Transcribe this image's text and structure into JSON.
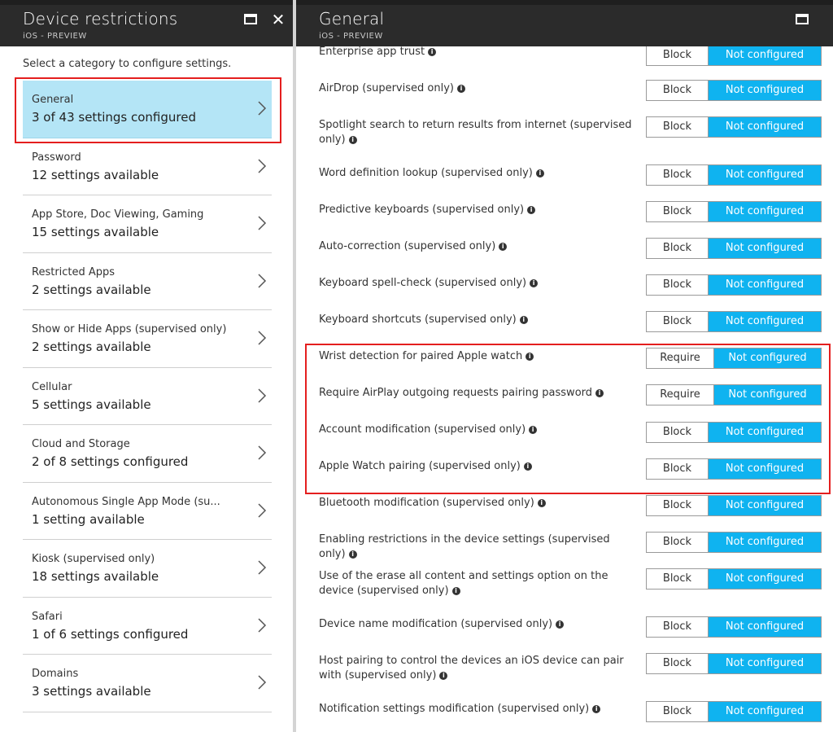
{
  "left": {
    "title": "Device restrictions",
    "subtitle": "iOS - PREVIEW",
    "intro": "Select a category to configure settings.",
    "categories": [
      {
        "title": "General",
        "sub": "3 of 43 settings configured"
      },
      {
        "title": "Password",
        "sub": "12 settings available"
      },
      {
        "title": "App Store, Doc Viewing, Gaming",
        "sub": "15 settings available"
      },
      {
        "title": "Restricted Apps",
        "sub": "2 settings available"
      },
      {
        "title": "Show or Hide Apps (supervised only)",
        "sub": "2 settings available"
      },
      {
        "title": "Cellular",
        "sub": "5 settings available"
      },
      {
        "title": "Cloud and Storage",
        "sub": "2 of 8 settings configured"
      },
      {
        "title": "Autonomous Single App Mode (su...",
        "sub": "1 setting available"
      },
      {
        "title": "Kiosk (supervised only)",
        "sub": "18 settings available"
      },
      {
        "title": "Safari",
        "sub": "1 of 6 settings configured"
      },
      {
        "title": "Domains",
        "sub": "3 settings available"
      }
    ]
  },
  "right": {
    "title": "General",
    "subtitle": "iOS - PREVIEW",
    "settings": [
      {
        "label": "Enterprise app trust",
        "a": "Block",
        "b": "Not configured"
      },
      {
        "label": "AirDrop (supervised only)",
        "a": "Block",
        "b": "Not configured"
      },
      {
        "label": "Spotlight search to return results from internet (supervised only)",
        "a": "Block",
        "b": "Not configured"
      },
      {
        "label": "Word definition lookup (supervised only)",
        "a": "Block",
        "b": "Not configured"
      },
      {
        "label": "Predictive keyboards (supervised only)",
        "a": "Block",
        "b": "Not configured"
      },
      {
        "label": "Auto-correction (supervised only)",
        "a": "Block",
        "b": "Not configured"
      },
      {
        "label": "Keyboard spell-check (supervised only)",
        "a": "Block",
        "b": "Not configured"
      },
      {
        "label": "Keyboard shortcuts (supervised only)",
        "a": "Block",
        "b": "Not configured"
      },
      {
        "label": "Wrist detection for paired Apple watch",
        "a": "Require",
        "b": "Not configured"
      },
      {
        "label": "Require AirPlay outgoing requests pairing password",
        "a": "Require",
        "b": "Not configured"
      },
      {
        "label": "Account modification (supervised only)",
        "a": "Block",
        "b": "Not configured"
      },
      {
        "label": "Apple Watch pairing (supervised only)",
        "a": "Block",
        "b": "Not configured"
      },
      {
        "label": "Bluetooth modification (supervised only)",
        "a": "Block",
        "b": "Not configured"
      },
      {
        "label": "Enabling restrictions in the device settings (supervised only)",
        "a": "Block",
        "b": "Not configured"
      },
      {
        "label": "Use of the erase all content and settings option on the device (supervised only)",
        "a": "Block",
        "b": "Not configured"
      },
      {
        "label": "Device name modification (supervised only)",
        "a": "Block",
        "b": "Not configured"
      },
      {
        "label": "Host pairing to control the devices an iOS device can pair with (supervised only)",
        "a": "Block",
        "b": "Not configured"
      },
      {
        "label": "Notification settings modification (supervised only)",
        "a": "Block",
        "b": "Not configured"
      }
    ]
  },
  "colors": {
    "header_bg": "#2b2b2b",
    "selected_bg": "#b4e5f6",
    "toggle_active": "#0fb3f0",
    "highlight_border": "#e41e1e"
  },
  "icons": {
    "maximize": "maximize-icon",
    "close": "close-icon",
    "chevron": "chevron-right-icon",
    "info": "info-icon"
  }
}
